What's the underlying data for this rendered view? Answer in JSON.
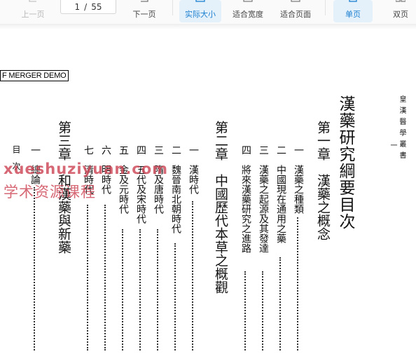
{
  "toolbar": {
    "prev_page": "上一页",
    "page_current": "1",
    "page_separator": "/",
    "page_total": "55",
    "next_page": "下一页",
    "actual_size": "实际大小",
    "fit_width": "适合宽度",
    "fit_page": "适合页面",
    "single_page": "单页",
    "double_page": "双页",
    "accent": "#1a7fd0"
  },
  "document": {
    "stamp_text": "F MERGER DEMO",
    "watermark_line1": "xueshuziyuan.com",
    "watermark_line2": "学术资源课程",
    "margin_note": "皇漢醫學叢書",
    "margin_note_2": "一",
    "title": "漢藥研究綱要目次",
    "chapter1": "第一章　漢藥之概念",
    "ch1_items": [
      "一　漢藥之種類",
      "二　中國現在通用之藥",
      "三　漢藥之起源及其發達",
      "四　將來漢藥研究之進路"
    ],
    "chapter2": "第二章　中國歷代本草之概觀",
    "ch2_items": [
      "一　漢時代",
      "二　魏晉南北朝時代",
      "三　隋及唐時代",
      "四　五代及宋時代",
      "五　金及元時代",
      "六　明時代",
      "七　清時代"
    ],
    "chapter3": "第三章　和漢藥與新藥",
    "ch3_items": [
      "一　總論",
      "目　次"
    ]
  }
}
